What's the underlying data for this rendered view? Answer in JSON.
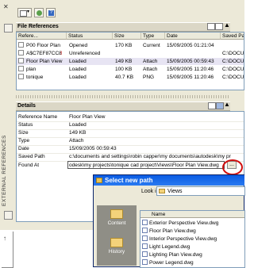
{
  "sidebar": {
    "title": "EXTERNAL REFERENCES",
    "close_glyph": "✕"
  },
  "file_refs": {
    "header": "File References",
    "columns": [
      "Refere...",
      "Status",
      "Size",
      "Type",
      "Date",
      "Saved Pa"
    ],
    "rows": [
      {
        "name": "P00 Floor Plan",
        "status": "Opened",
        "size": "170 KB",
        "type": "Current",
        "date": "15/09/2005 01:21:04",
        "saved": "",
        "warn": false
      },
      {
        "name": "A$C7EF87CC8",
        "status": "Unreferenced",
        "size": "",
        "type": "",
        "date": "",
        "saved": "C:\\DOCU",
        "warn": true
      },
      {
        "name": "Floor Plan View",
        "status": "Loaded",
        "size": "149 KB",
        "type": "Attach",
        "date": "15/09/2005 00:59:43",
        "saved": "C:\\DOCU",
        "warn": false
      },
      {
        "name": "plan",
        "status": "Loaded",
        "size": "100 KB",
        "type": "Attach",
        "date": "15/09/2005 11:20:46",
        "saved": "C:\\DOCU",
        "warn": false
      },
      {
        "name": "tonique",
        "status": "Loaded",
        "size": "40.7 KB",
        "type": "PNG",
        "date": "15/09/2005 11:20:46",
        "saved": "C:\\DOCU",
        "warn": false
      }
    ]
  },
  "details": {
    "header": "Details",
    "rows": [
      {
        "key": "Reference Name",
        "value": "Floor Plan View"
      },
      {
        "key": "Status",
        "value": "Loaded"
      },
      {
        "key": "Size",
        "value": "149 KB"
      },
      {
        "key": "Type",
        "value": "Attach"
      },
      {
        "key": "Date",
        "value": "15/09/2005 00:59:43"
      },
      {
        "key": "Saved Path",
        "value": "c:\\documents and settings\\robin capper\\my documents\\autodesk\\my pr"
      }
    ],
    "found_at_label": "Found At",
    "found_at_value": "odesk\\my projects\\tonique cad project\\Views\\Floor Plan View.dwg",
    "browse_label": "..."
  },
  "dialog": {
    "title": "Select new path",
    "look_in_label": "Look in:",
    "look_in_value": "Views",
    "places": [
      "Content",
      "History"
    ],
    "list_header": "Name",
    "files": [
      "Exterior Perspective View.dwg",
      "Floor Plan View.dwg",
      "Interior Perspective View.dwg",
      "Light Legend.dwg",
      "Lighting Plan View.dwg",
      "Power Legend.dwg"
    ]
  }
}
